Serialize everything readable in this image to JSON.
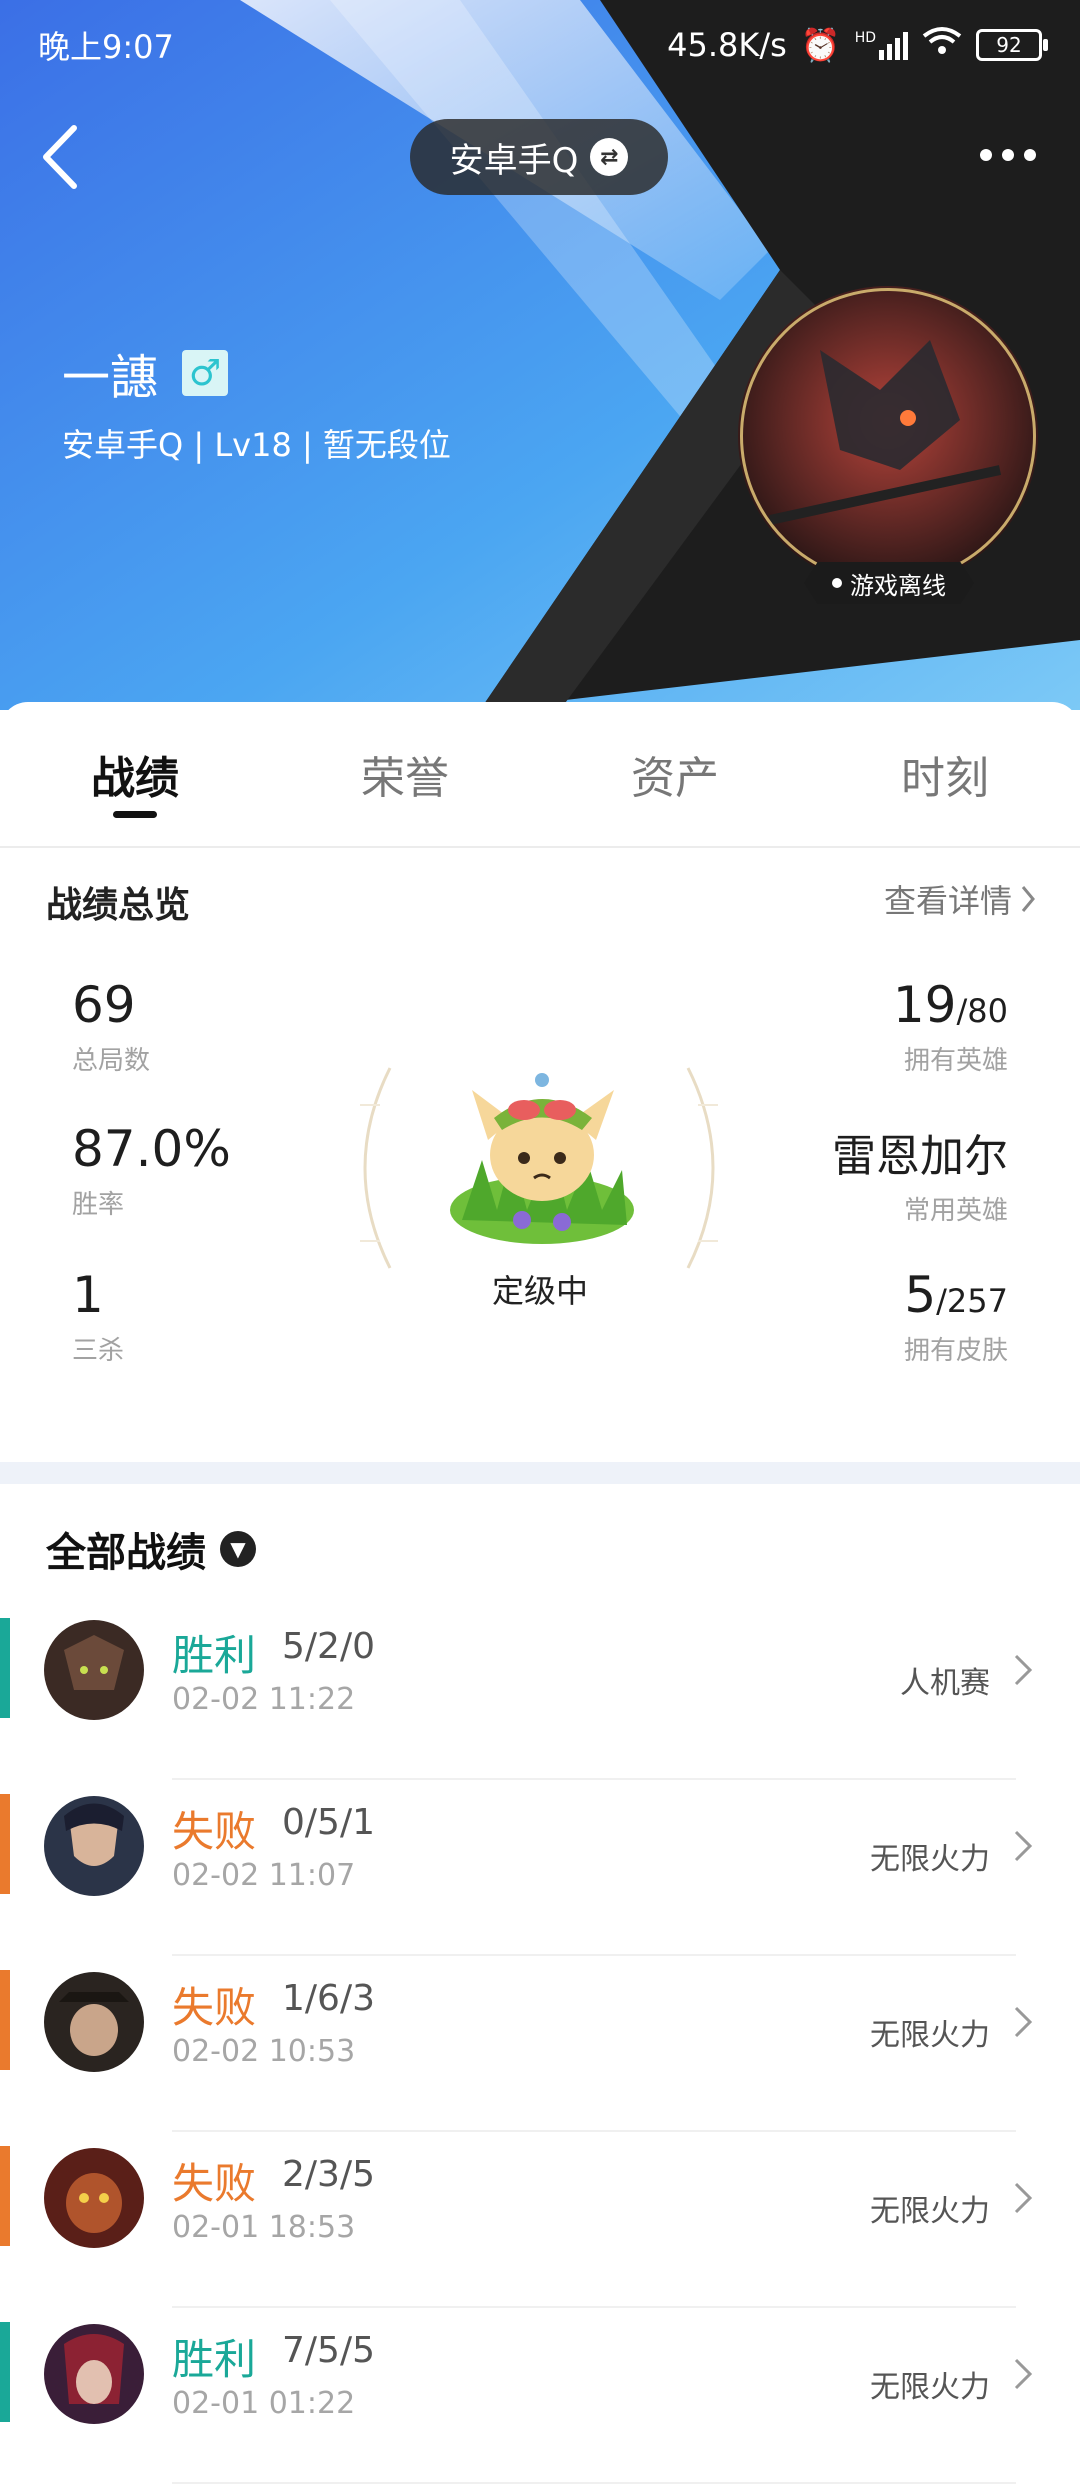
{
  "status_bar": {
    "time": "晚上9:07",
    "net_speed": "45.8K/s",
    "signal_label": "HD",
    "battery": "92"
  },
  "header": {
    "account_label": "安卓手Q"
  },
  "profile": {
    "name": "一譓",
    "gender_symbol": "♂",
    "subtitle": "安卓手Q | Lv18 | 暂无段位",
    "online_status": "游戏离线"
  },
  "tabs": [
    "战绩",
    "荣誉",
    "资产",
    "时刻"
  ],
  "overview": {
    "title": "战绩总览",
    "details_link": "查看详情",
    "rank_status": "定级中",
    "left": [
      {
        "value": "69",
        "label": "总局数"
      },
      {
        "value": "87.0%",
        "label": "胜率"
      },
      {
        "value": "1",
        "label": "三杀"
      }
    ],
    "right": [
      {
        "value": "19",
        "suffix": "/80",
        "label": "拥有英雄"
      },
      {
        "value": "雷恩加尔",
        "suffix": "",
        "label": "常用英雄"
      },
      {
        "value": "5",
        "suffix": "/257",
        "label": "拥有皮肤"
      }
    ]
  },
  "matches": {
    "title": "全部战绩",
    "items": [
      {
        "result": "胜利",
        "kda": "5/2/0",
        "time": "02-02 11:22",
        "mode": "人机赛",
        "win": true
      },
      {
        "result": "失败",
        "kda": "0/5/1",
        "time": "02-02 11:07",
        "mode": "无限火力",
        "win": false
      },
      {
        "result": "失败",
        "kda": "1/6/3",
        "time": "02-02 10:53",
        "mode": "无限火力",
        "win": false
      },
      {
        "result": "失败",
        "kda": "2/3/5",
        "time": "02-01 18:53",
        "mode": "无限火力",
        "win": false
      },
      {
        "result": "胜利",
        "kda": "7/5/5",
        "time": "02-01 01:22",
        "mode": "无限火力",
        "win": true
      }
    ]
  },
  "colors": {
    "win": "#1aa898",
    "loss": "#ea7a2d",
    "hero_blue": "#3f7ff0",
    "hero_dark": "#1a1a1a"
  },
  "icons": {
    "back": "chevron-left-icon",
    "more": "more-dots-icon",
    "swap": "swap-icon",
    "dropdown": "chevron-down-circle-icon",
    "row_chevron": "chevron-right-icon"
  }
}
